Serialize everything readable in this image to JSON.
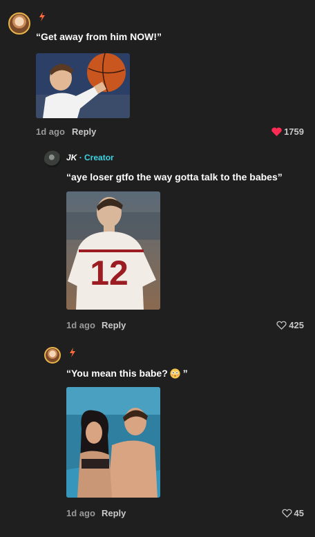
{
  "comments": [
    {
      "text": "“Get away from him NOW!”",
      "time": "1d ago",
      "reply": "Reply",
      "likes": "1759",
      "liked": true
    }
  ],
  "replies": [
    {
      "author": "JK",
      "badge": "· Creator",
      "text": "“aye loser gtfo the way gotta talk to the babes”",
      "time": "1d ago",
      "reply": "Reply",
      "likes": "425",
      "liked": false
    },
    {
      "text": "“You mean this babe?",
      "text_end": "”",
      "emoji": "😳",
      "time": "1d ago",
      "reply": "Reply",
      "likes": "45",
      "liked": false
    }
  ],
  "icons": {
    "bolt": "ϟ",
    "heart_filled": "heart-filled-icon",
    "heart_outline": "heart-outline-icon"
  },
  "colors": {
    "background": "#1f1f1f",
    "liked_heart": "#fe2c55",
    "creator_badge": "#3fd4e5",
    "bolt": "#ff6a3d"
  }
}
